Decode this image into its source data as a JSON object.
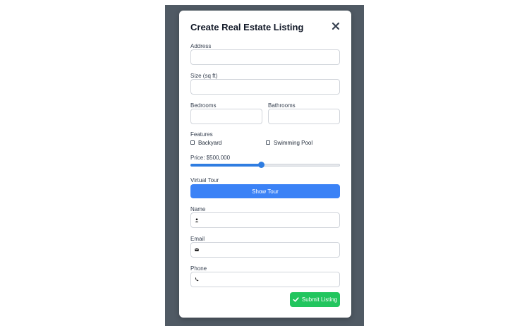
{
  "modal": {
    "title": "Create Real Estate Listing",
    "close_icon": "close-icon"
  },
  "form": {
    "address_label": "Address",
    "size_label": "Size (sq ft)",
    "bedrooms_label": "Bedrooms",
    "bathrooms_label": "Bathrooms",
    "features_label": "Features",
    "features": [
      {
        "label": "Backyard",
        "checked": false
      },
      {
        "label": "Swimming Pool",
        "checked": false
      }
    ],
    "price_label": "Price: $500,000",
    "price_slider_fraction": 0.47,
    "virtual_tour_label": "Virtual Tour",
    "show_tour_button": "Show Tour",
    "name_label": "Name",
    "name_icon": "user-icon",
    "email_label": "Email",
    "email_icon": "envelope-icon",
    "phone_label": "Phone",
    "phone_icon": "phone-icon",
    "submit_button": "Submit Listing",
    "submit_icon": "check-icon"
  },
  "colors": {
    "backdrop": "#505a64",
    "primary": "#3b82f6",
    "success": "#22c55e"
  }
}
